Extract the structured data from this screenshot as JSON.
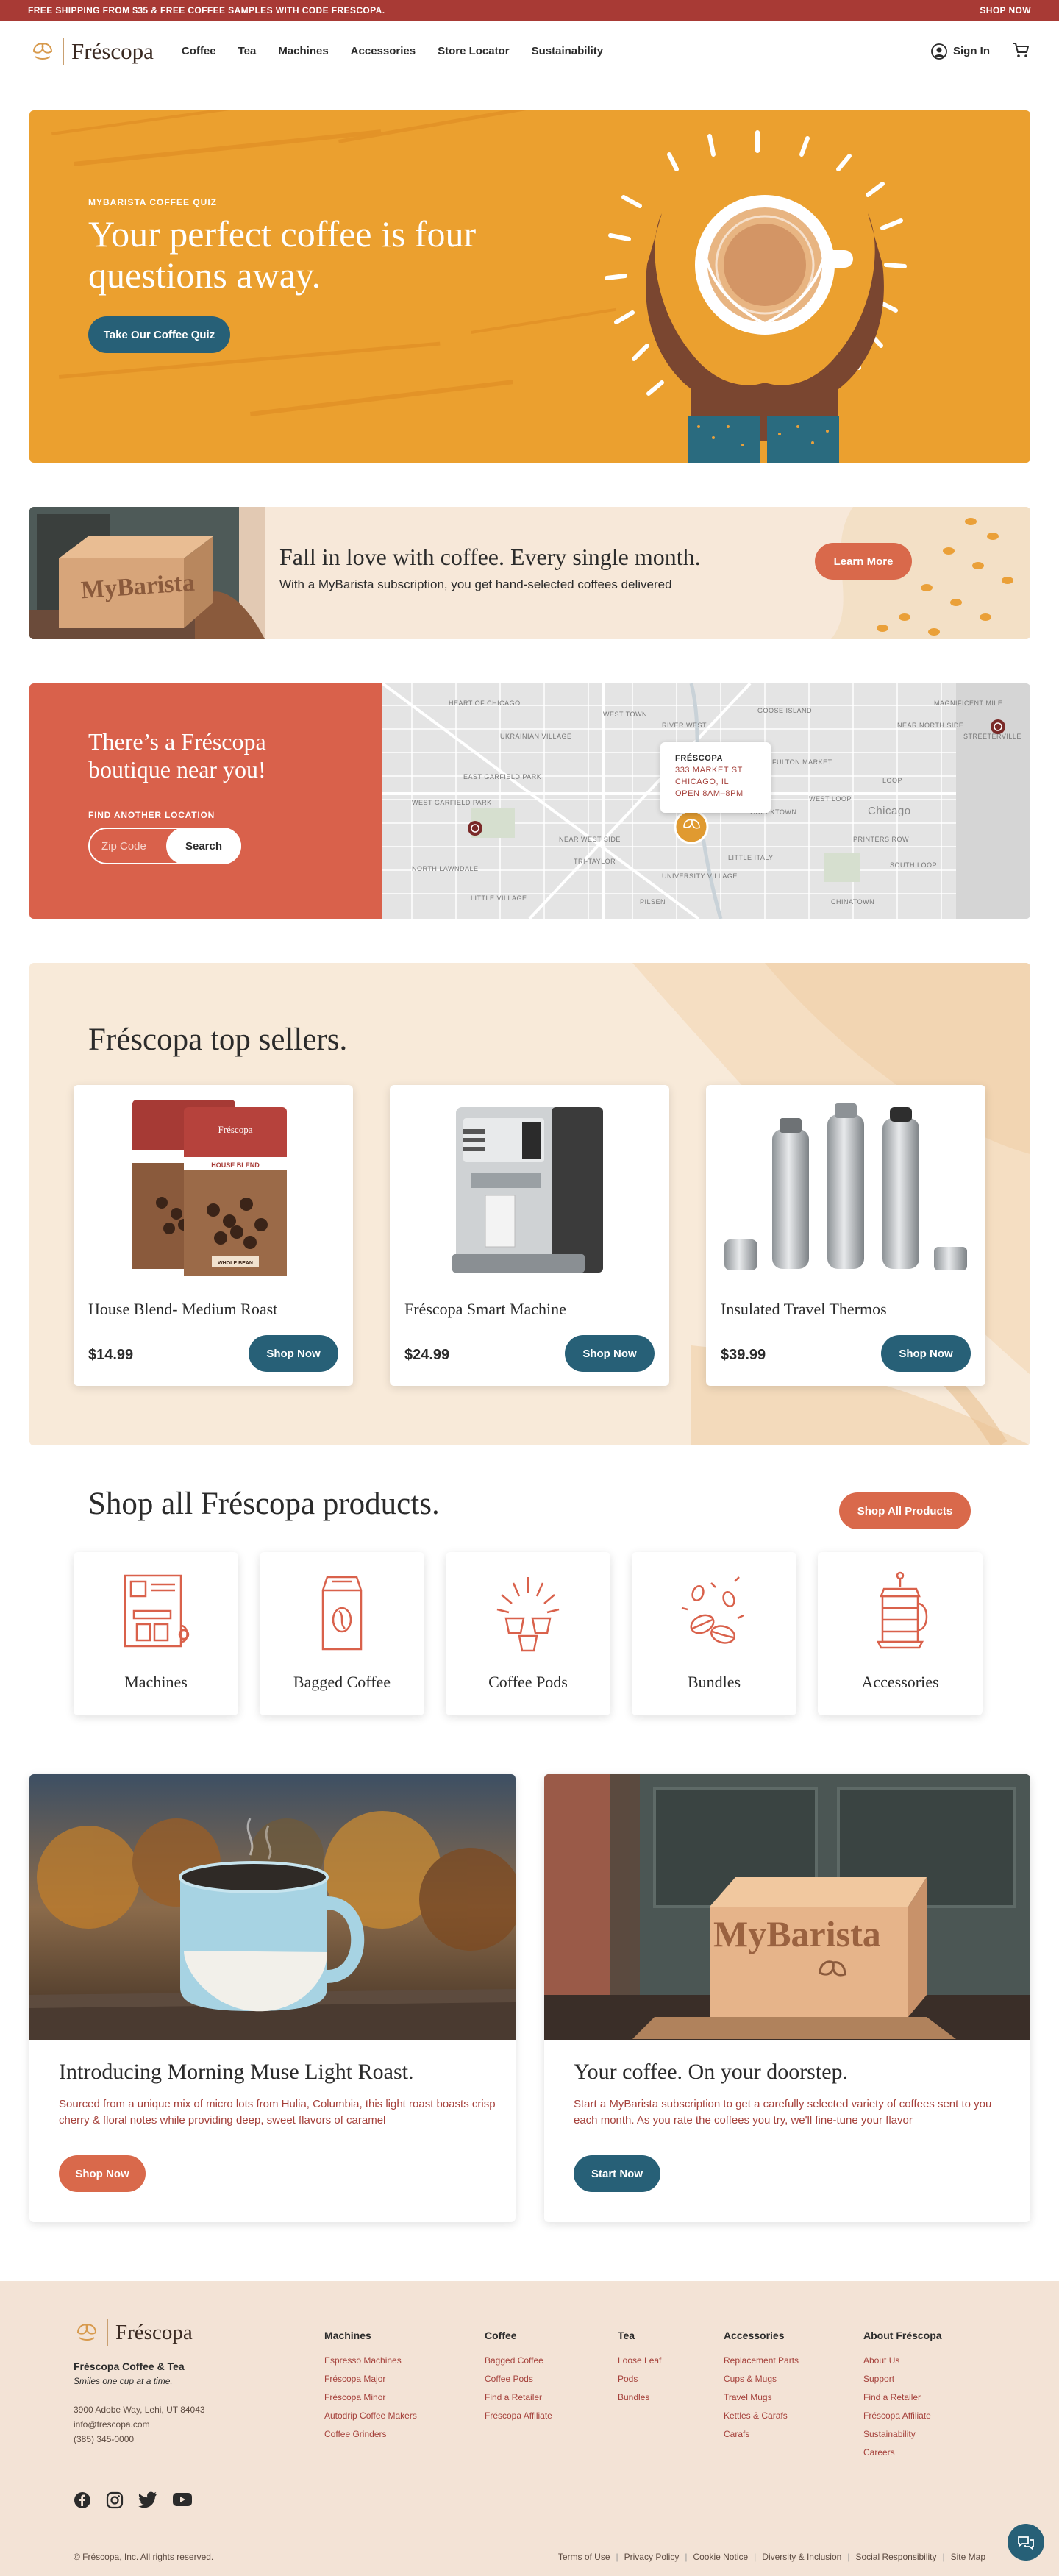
{
  "promo": {
    "text": "FREE SHIPPING FROM $35 & FREE COFFEE SAMPLES WITH CODE FRESCOPA.",
    "cta": "SHOP NOW"
  },
  "header": {
    "brand": "Fréscopa",
    "nav": [
      "Coffee",
      "Tea",
      "Machines",
      "Accessories",
      "Store Locator",
      "Sustainability"
    ],
    "sign_in": "Sign In",
    "icons": {
      "user": "user-circle-icon",
      "cart": "cart-icon"
    }
  },
  "hero": {
    "eyebrow": "MYBARISTA COFFEE QUIZ",
    "title": "Your perfect coffee is four questions away.",
    "button": "Take Our Coffee Quiz"
  },
  "subscription": {
    "title": "Fall in love with coffee. Every single month.",
    "text": "With a MyBarista subscription, you get hand-selected coffees delivered",
    "button": "Learn More",
    "box_label": "MyBarista"
  },
  "store": {
    "title": "There’s a Fréscopa boutique near you!",
    "find_label": "FIND ANOTHER LOCATION",
    "zip_placeholder": "Zip Code",
    "search_button": "Search",
    "card": {
      "name": "FRÉSCOPA",
      "line1": "333 MARKET ST",
      "line2": "CHICAGO, IL",
      "line3": "OPEN 8AM–8PM"
    },
    "map_labels": [
      "WEST TOWN",
      "UKRAINIAN VILLAGE",
      "RIVER WEST",
      "GOOSE ISLAND",
      "MAGNIFICENT MILE",
      "NEAR NORTH SIDE",
      "STREETERVILLE",
      "FULTON MARKET",
      "WEST LOOP",
      "LOOP",
      "Chicago",
      "GREEKTOWN",
      "HEART OF CHICAGO",
      "PRINTERS ROW",
      "LITTLE ITALY",
      "UNIVERSITY VILLAGE",
      "SOUTH LOOP",
      "NEAR WEST SIDE",
      "EAST GARFIELD PARK",
      "WEST GARFIELD PARK",
      "TRI-TAYLOR",
      "NORTH LAWNDALE",
      "LITTLE VILLAGE",
      "PILSEN",
      "CHINATOWN"
    ]
  },
  "top_sellers": {
    "title": "Fréscopa top sellers.",
    "products": [
      {
        "name": "House Blend- Medium Roast",
        "price": "$14.99",
        "button": "Shop Now"
      },
      {
        "name": "Fréscopa Smart Machine",
        "price": "$24.99",
        "button": "Shop Now"
      },
      {
        "name": "Insulated Travel Thermos",
        "price": "$39.99",
        "button": "Shop Now"
      }
    ],
    "bag_label": "HOUSE BLEND",
    "bag_sub": "WHOLE BEAN",
    "bag_brand": "Fréscopa"
  },
  "shop_all": {
    "title": "Shop all Fréscopa products.",
    "button": "Shop All Products",
    "categories": [
      "Machines",
      "Bagged Coffee",
      "Coffee Pods",
      "Bundles",
      "Accessories"
    ]
  },
  "features": [
    {
      "title": "Introducing Morning Muse Light Roast.",
      "text": "Sourced from a unique mix of micro lots from Hulia, Columbia, this light roast boasts crisp cherry & floral notes while providing deep, sweet flavors of caramel",
      "button": "Shop Now"
    },
    {
      "title": "Your coffee. On your doorstep.",
      "text": "Start a MyBarista subscription to get a carefully selected variety of coffees sent to you each month. As you rate the coffees you try, we'll fine-tune your flavor",
      "button": "Start Now",
      "box_label": "MyBarista"
    }
  ],
  "footer": {
    "brand": "Fréscopa",
    "company": "Fréscopa Coffee & Tea",
    "tagline": "Smiles one cup at a time.",
    "address": "3900 Adobe Way, Lehi, UT 84043",
    "email": "info@frescopa.com",
    "phone": "(385) 345-0000",
    "columns": [
      {
        "heading": "Machines",
        "links": [
          "Espresso Machines",
          "Fréscopa Major",
          "Fréscopa Minor",
          "Autodrip Coffee Makers",
          "Coffee Grinders"
        ]
      },
      {
        "heading": "Coffee",
        "links": [
          "Bagged Coffee",
          "Coffee Pods",
          "Find a Retailer",
          "Fréscopa Affiliate"
        ]
      },
      {
        "heading": "Tea",
        "links": [
          "Loose Leaf",
          "Pods",
          "Bundles"
        ]
      },
      {
        "heading": "Accessories",
        "links": [
          "Replacement Parts",
          "Cups & Mugs",
          "Travel Mugs",
          "Kettles & Carafs",
          "Carafs"
        ]
      },
      {
        "heading": "About Fréscopa",
        "links": [
          "About Us",
          "Support",
          "Find a Retailer",
          "Fréscopa Affiliate",
          "Sustainability",
          "Careers"
        ]
      }
    ],
    "social_icons": [
      "facebook-icon",
      "instagram-icon",
      "twitter-icon",
      "youtube-icon"
    ],
    "copyright": "© Fréscopa, Inc. All rights reserved.",
    "legal": [
      "Terms of Use",
      "Privacy Policy",
      "Cookie Notice",
      "Diversity & Inclusion",
      "Social Responsibility",
      "Site Map"
    ]
  },
  "colors": {
    "brand_red": "#a83a35",
    "teal": "#276077",
    "coral": "#d9694b",
    "hero_orange": "#eba02f",
    "cream": "#f8ead9"
  }
}
